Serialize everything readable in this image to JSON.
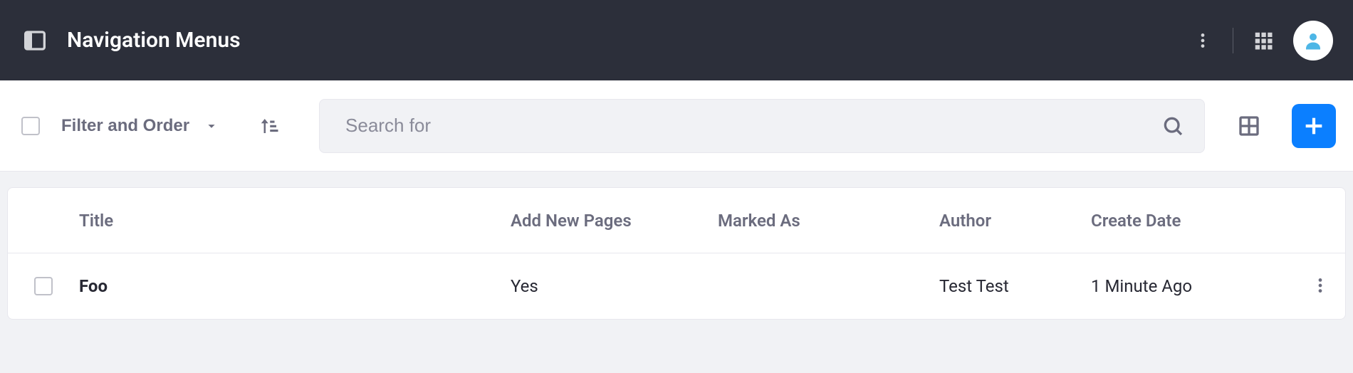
{
  "header": {
    "title": "Navigation Menus"
  },
  "toolbar": {
    "filter_order_label": "Filter and Order",
    "search_placeholder": "Search for"
  },
  "table": {
    "columns": {
      "title": "Title",
      "add_new_pages": "Add New Pages",
      "marked_as": "Marked As",
      "author": "Author",
      "create_date": "Create Date"
    },
    "rows": [
      {
        "title": "Foo",
        "add_new_pages": "Yes",
        "marked_as": "",
        "author": "Test Test",
        "create_date": "1 Minute Ago"
      }
    ]
  },
  "colors": {
    "primary": "#0b7fff",
    "header_bg": "#2c2f3a"
  }
}
